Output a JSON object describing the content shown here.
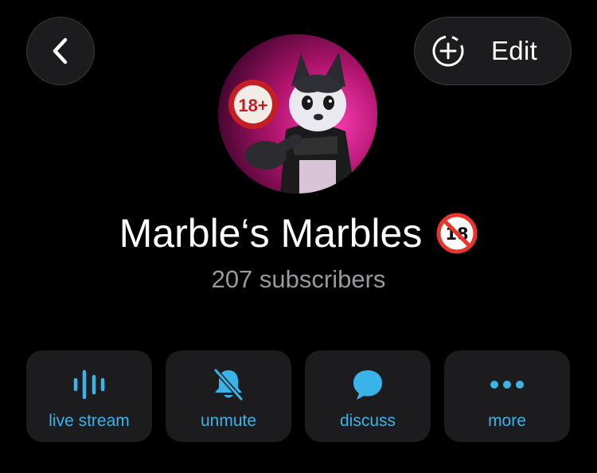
{
  "header": {
    "edit_label": "Edit"
  },
  "avatar": {
    "badge_text": "18+"
  },
  "channel": {
    "name": "Marble‘s Marbles",
    "subscribers": "207 subscribers"
  },
  "actions": [
    {
      "label": "live stream",
      "icon": "live-stream-icon"
    },
    {
      "label": "unmute",
      "icon": "bell-slash-icon"
    },
    {
      "label": "discuss",
      "icon": "chat-bubble-icon"
    },
    {
      "label": "more",
      "icon": "ellipsis-icon"
    }
  ],
  "colors": {
    "accent": "#3ab3e8",
    "background": "#000000",
    "surface": "#1c1c1e",
    "secondary_text": "#98989f"
  }
}
